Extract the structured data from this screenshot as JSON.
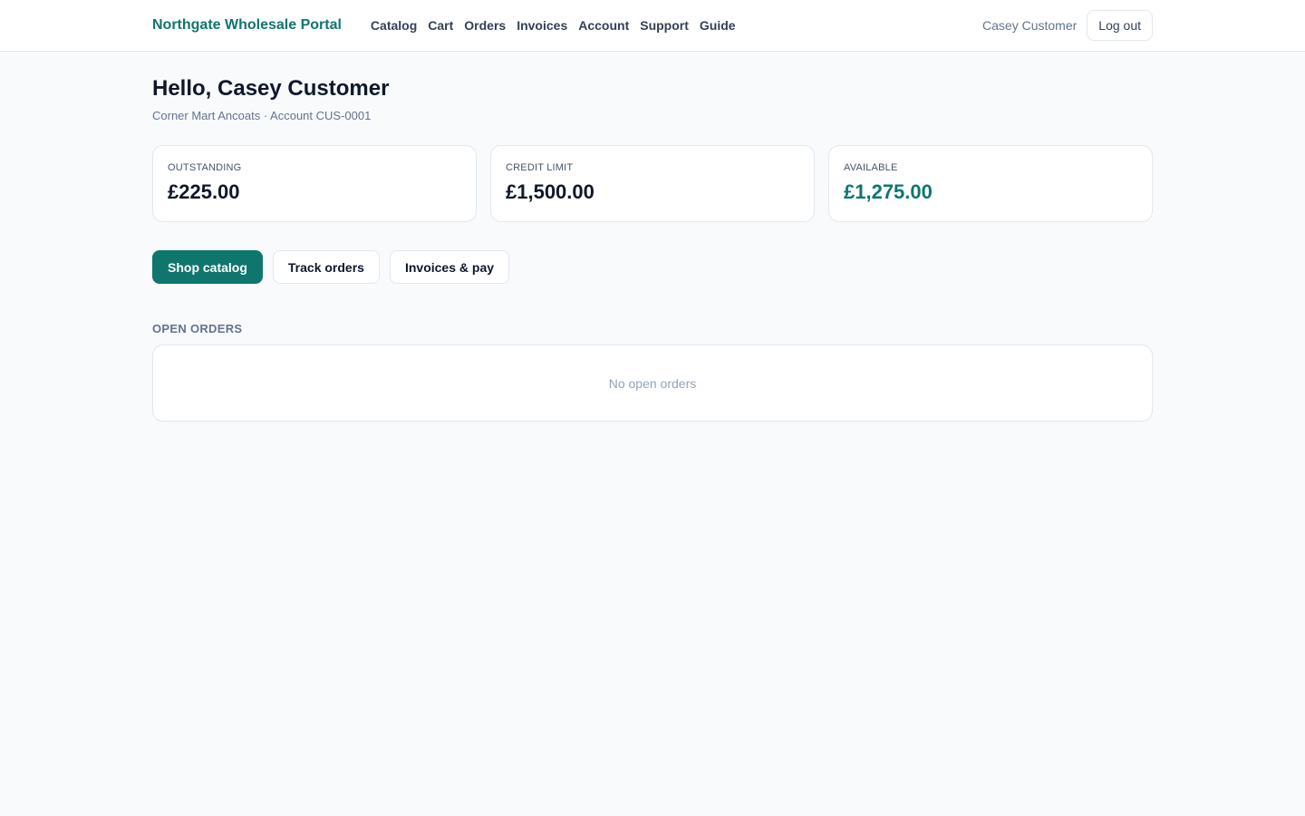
{
  "header": {
    "brand": "Northgate Wholesale Portal",
    "nav": [
      "Catalog",
      "Cart",
      "Orders",
      "Invoices",
      "Account",
      "Support",
      "Guide"
    ],
    "user_name": "Casey Customer",
    "logout_label": "Log out"
  },
  "greeting": "Hello, Casey Customer",
  "subtitle": "Corner Mart Ancoats · Account CUS-0001",
  "stats": [
    {
      "label": "OUTSTANDING",
      "value": "£225.00"
    },
    {
      "label": "CREDIT LIMIT",
      "value": "£1,500.00"
    },
    {
      "label": "AVAILABLE",
      "value": "£1,275.00"
    }
  ],
  "actions": {
    "shop": "Shop catalog",
    "track": "Track orders",
    "invoices": "Invoices & pay"
  },
  "open_orders": {
    "title": "OPEN ORDERS",
    "empty": "No open orders"
  },
  "colors": {
    "accent": "#0f766e",
    "background": "#f8fafc",
    "border": "#e2e8f0"
  }
}
